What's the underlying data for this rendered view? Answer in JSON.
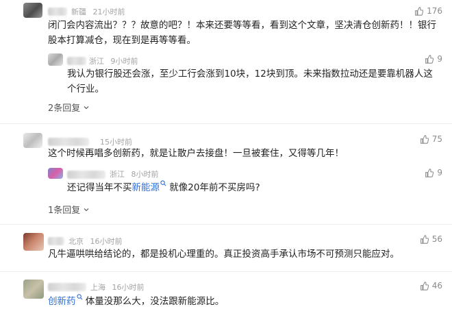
{
  "comments": [
    {
      "location": "新疆",
      "time": "21小时前",
      "likes": "176",
      "text": "闭门会内容流出？？？故意的吧？！本来还要等等看，看到这个文章，坚决清仓创新药！！银行股本打算减仓，现在到是再等等看。",
      "reply": {
        "location": "浙江",
        "time": "9小时前",
        "likes": "9",
        "text": "我认为银行股还会涨，至少工行会涨到10块，12块到顶。未来指数拉动还是要靠机器人这个行业。"
      },
      "more_label": "2条回复"
    },
    {
      "location": "",
      "time": "15小时前",
      "likes": "75",
      "text": "这个时候再唱多创新药，就是让散户去接盘！一旦被套住，又得等几年！",
      "reply": {
        "location": "浙江",
        "time": "8小时前",
        "likes": "9",
        "text_before": "还记得当年不买",
        "keyword": "新能源",
        "text_after": "就像20年前不买房吗?"
      },
      "more_label": "1条回复"
    },
    {
      "location": "北京",
      "time": "16小时前",
      "likes": "56",
      "text": "凡牛逼哄哄给结论的，都是投机心理重的。真正投资高手承认市场不可预测只能应对。"
    },
    {
      "location": "上海",
      "time": "16小时前",
      "likes": "46",
      "keyword": "创新药",
      "text_after": "体量没那么大，没法跟新能源比。"
    }
  ],
  "icons": {
    "like": "thumbs-up-icon",
    "expand": "chevron-down-icon",
    "search": "search-icon"
  },
  "colors": {
    "keyword": "#2f6fd6",
    "meta": "#a3a3a3"
  }
}
